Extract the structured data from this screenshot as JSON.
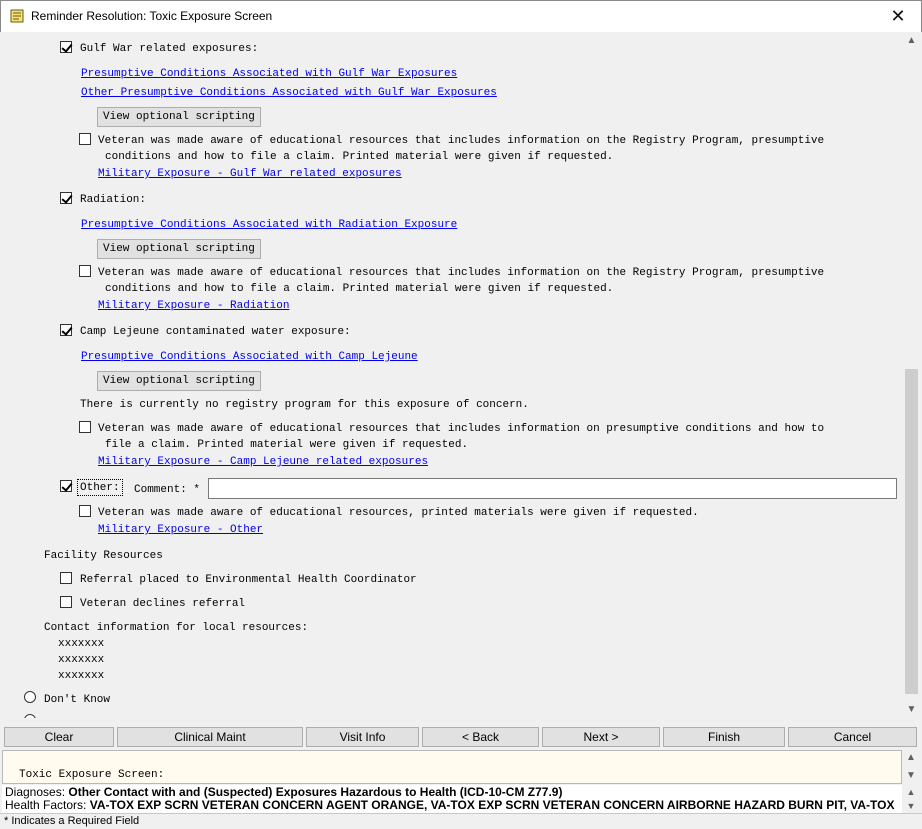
{
  "window": {
    "title": "Reminder Resolution: Toxic Exposure Screen",
    "close_glyph": "✕"
  },
  "content": {
    "gulf_war": {
      "label": "Gulf War related exposures:",
      "checked": true,
      "link1": "Presumptive Conditions Associated with Gulf War Exposures",
      "link2": "Other Presumptive Conditions Associated with Gulf War Exposures",
      "script_button": "View optional scripting",
      "aware_line1": "Veteran was made aware of educational resources that includes information on the Registry Program, presumptive",
      "aware_line2": "conditions and how to file a claim.  Printed material were given if requested.",
      "aware_link": "Military Exposure - Gulf War related exposures"
    },
    "radiation": {
      "label": "Radiation:",
      "checked": true,
      "link1": "Presumptive Conditions Associated with Radiation Exposure",
      "script_button": "View optional scripting",
      "aware_line1": "Veteran was made aware of educational resources that includes information on the Registry Program, presumptive",
      "aware_line2": "conditions and how to file a claim.  Printed material were given if requested.",
      "aware_link": "Military Exposure - Radiation"
    },
    "camp_lejeune": {
      "label": "Camp Lejeune contaminated water exposure:",
      "checked": true,
      "link1": "Presumptive Conditions Associated with Camp Lejeune",
      "script_button": "View optional scripting",
      "note": "There is currently no registry program for this exposure of concern.",
      "aware_line1": "Veteran was made aware of educational resources that includes information on presumptive conditions and how to",
      "aware_line2": "file a claim.  Printed material were given if requested.",
      "aware_link": "Military Exposure - Camp Lejeune related exposures"
    },
    "other": {
      "label": "Other:",
      "checked": true,
      "comment_label": "Comment: *",
      "comment_value": "",
      "aware_line1": "Veteran was made aware of educational resources, printed materials were given if requested.",
      "aware_link": "Military Exposure - Other"
    },
    "facility": {
      "heading": "Facility Resources",
      "referral_placed": "Referral placed to Environmental Health Coordinator",
      "referral_declined": "Veteran declines referral"
    },
    "contact": {
      "heading": "Contact information for local resources:",
      "lines": [
        "xxxxxxx",
        "xxxxxxx",
        "xxxxxxx"
      ]
    },
    "dont_know": "Don't Know"
  },
  "buttons": {
    "clear": "Clear",
    "clinical_maint": "Clinical Maint",
    "visit_info": "Visit Info",
    "back": "< Back",
    "next": "Next >",
    "finish": "Finish",
    "cancel": "Cancel"
  },
  "preview": {
    "text": "Toxic Exposure Screen:"
  },
  "status": {
    "diagnoses_label": "Diagnoses:",
    "diagnoses_value": "Other Contact with and (Suspected) Exposures Hazardous to Health (ICD-10-CM Z77.9)",
    "health_factors_label": "Health Factors:",
    "health_factors_value": "VA-TOX EXP SCRN VETERAN CONCERN AGENT ORANGE, VA-TOX EXP SCRN VETERAN CONCERN AIRBORNE HAZARD BURN PIT, VA-TOX"
  },
  "footer": {
    "required_note": "* Indicates a Required Field"
  },
  "icons": {
    "scroll_up": "▲",
    "scroll_down": "▼"
  }
}
